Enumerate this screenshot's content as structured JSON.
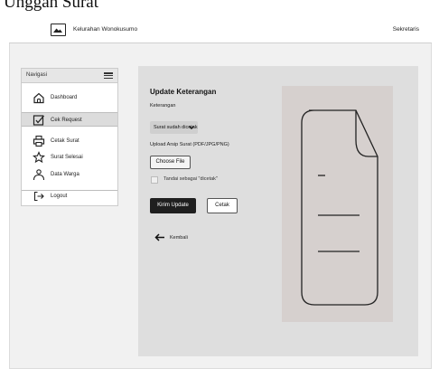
{
  "caption": "Unggah Surat",
  "header": {
    "brand": "Kelurahan Wonokusumo",
    "role": "Sekretaris",
    "logo_icon": "image-icon"
  },
  "sidebar": {
    "title": "Navigasi",
    "menu_icon": "hamburger-icon",
    "active_index": 1,
    "items": [
      {
        "label": "Dashboard",
        "icon": "home-icon"
      },
      {
        "label": "Cek Request",
        "icon": "checkbox-edit-icon"
      },
      {
        "label": "Cetak Surat",
        "icon": "printer-icon"
      },
      {
        "label": "Surat Selesai",
        "icon": "star-icon"
      },
      {
        "label": "Data Warga",
        "icon": "users-icon"
      },
      {
        "label": "Logout",
        "icon": "logout-icon"
      }
    ]
  },
  "form": {
    "title": "Update Keterangan",
    "keterangan_label": "Keterangan",
    "keterangan_value": "Surat sudah dicetak",
    "upload_label": "Upload Arsip Surat (PDF/JPG/PNG)",
    "choose_file_label": "Choose File",
    "checkbox_label": "Tandai sebagai \"dicetak\"",
    "checkbox_checked": false,
    "submit_label": "Kirim Update",
    "print_label": "Cetak",
    "back_label": "Kembali",
    "back_icon": "arrow-left-icon"
  },
  "preview": {
    "icon": "document-icon",
    "background": "#d6d0ce"
  },
  "colors": {
    "primary_button": "#1f1f1f",
    "panel": "#dedede",
    "sidebar_active": "#dcdcdc"
  }
}
